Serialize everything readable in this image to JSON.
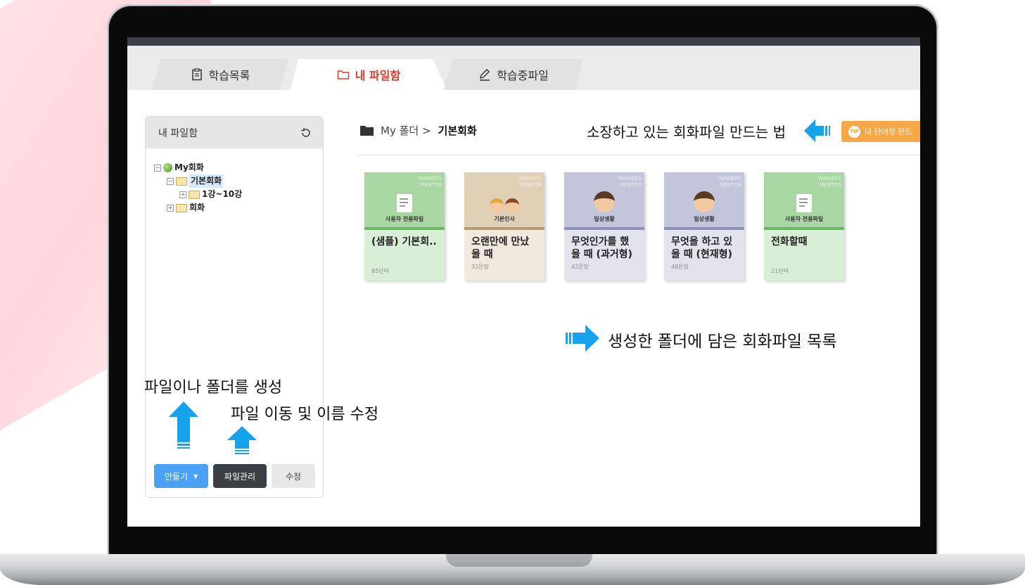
{
  "tabs": [
    {
      "label": "학습목록",
      "icon": "clipboard-icon"
    },
    {
      "label": "내 파일함",
      "icon": "folder-icon"
    },
    {
      "label": "학습중파일",
      "icon": "pencil-icon"
    }
  ],
  "sidebar": {
    "title": "내 파일함",
    "tree": {
      "root": "My회화",
      "child": "기본회화",
      "grandchild": "1강~10강",
      "sibling": "회화"
    },
    "buttons": {
      "create": "만들기",
      "manage": "파일관리",
      "edit": "수정"
    }
  },
  "breadcrumb": {
    "folder": "My 폴더 >",
    "current": "기본회화"
  },
  "tip": {
    "badge": "TIP",
    "label": "내 단어장 만드"
  },
  "cards": [
    {
      "category": "사용자 전용파일",
      "title": "(샘플) 기본회..",
      "count": "85단어",
      "watermark": "WINNERS\nMENTOR"
    },
    {
      "category": "기본인사",
      "title": "오랜만에 만났을 때",
      "count": "32문장",
      "watermark": "WINNERS\nMENTOR"
    },
    {
      "category": "일상생활",
      "title": "무엇인가를 했을 때 (과거형)",
      "count": "42문장",
      "watermark": "WINNERS\nMENTOR"
    },
    {
      "category": "일상생활",
      "title": "무엇을 하고 있을 때 (현재형)",
      "count": "48문장",
      "watermark": "WINNERS\nMENTOR"
    },
    {
      "category": "사용자 전용파일",
      "title": "전화할때",
      "count": "21단어",
      "watermark": "WINNERS\nMENTOR"
    }
  ],
  "annotations": {
    "how_to": "소장하고 있는 회화파일 만드는 법",
    "folder_list": "생성한 폴더에 담은 회화파일 목록",
    "create": "파일이나 폴더를 생성",
    "move": "파일 이동 및 이름 수정"
  },
  "colors": {
    "accent_red": "#e8392a",
    "blue_button": "#4aa1f4",
    "dark_button": "#3a3f44",
    "tip_orange": "#f7a745",
    "arrow_blue": "#17a3ec"
  }
}
